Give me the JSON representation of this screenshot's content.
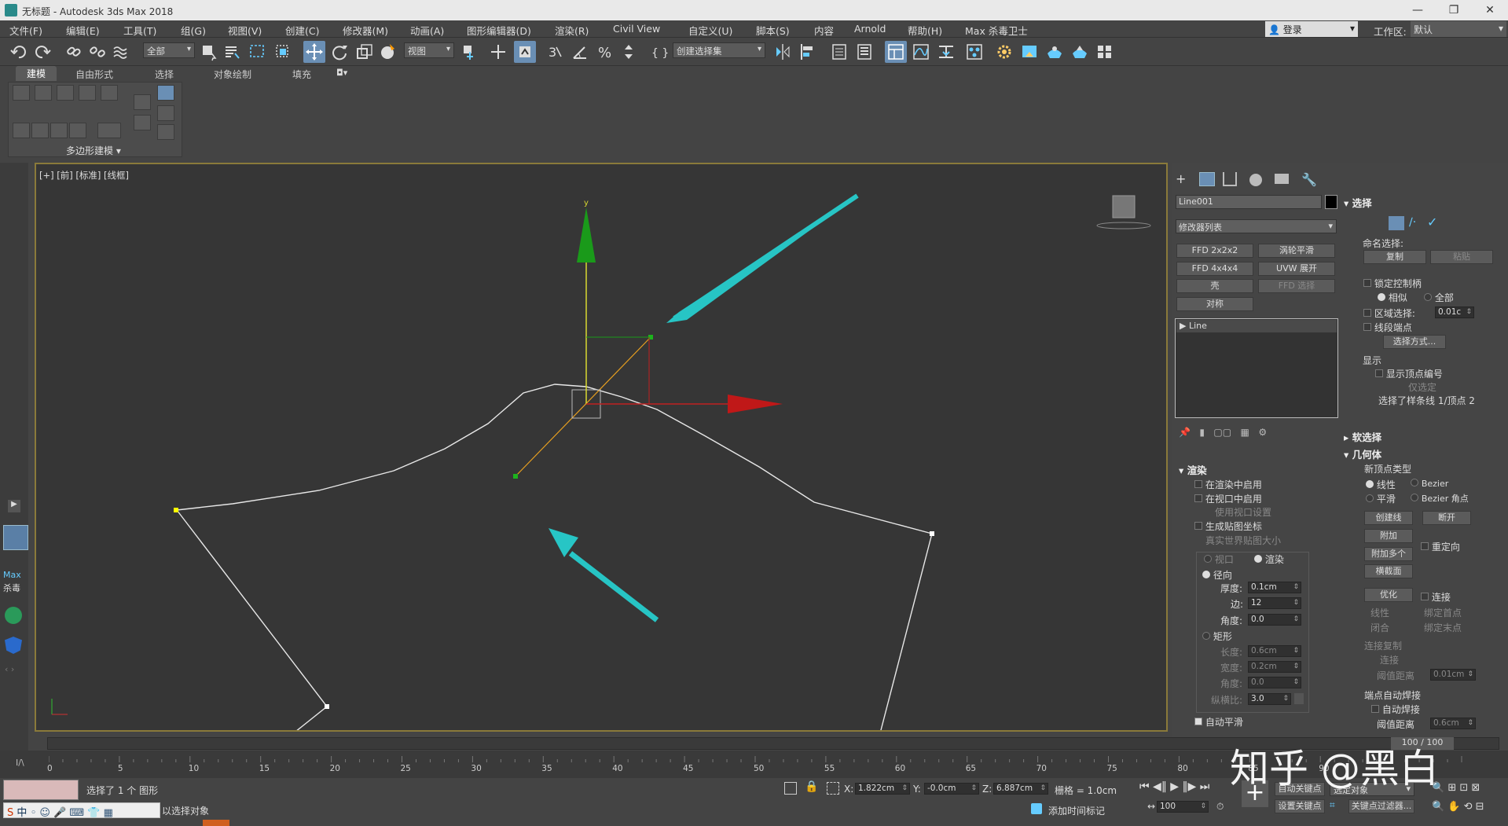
{
  "title_bar": {
    "title": "无标题 - Autodesk 3ds Max 2018",
    "min": "—",
    "max": "❐",
    "close": "✕"
  },
  "menus": [
    "文件(F)",
    "编辑(E)",
    "工具(T)",
    "组(G)",
    "视图(V)",
    "创建(C)",
    "修改器(M)",
    "动画(A)",
    "图形编辑器(D)",
    "渲染(R)",
    "Civil View",
    "自定义(U)",
    "脚本(S)",
    "内容",
    "Arnold",
    "帮助(H)",
    "Max 杀毒卫士"
  ],
  "login": "登录",
  "workspace": {
    "label": "工作区:",
    "value": "默认"
  },
  "toolbar": {
    "selection_filter": "全部",
    "ref_coord": "视图",
    "named_selection": "创建选择集"
  },
  "ribbon": {
    "tabs": [
      "建模",
      "自由形式",
      "选择",
      "对象绘制",
      "填充"
    ],
    "panel_label": "多边形建模"
  },
  "viewport": {
    "label": "[+] [前] [标准] [线框]",
    "gizmo_y": "y"
  },
  "left_sidebar": {
    "max_label_1": "Max",
    "max_label_2": "杀毒"
  },
  "command_panel": {
    "object_name": "Line001",
    "modifier_list": "修改器列表",
    "modifiers": [
      "FFD 2x2x2",
      "涡轮平滑",
      "FFD 4x4x4",
      "UVW 展开",
      "壳",
      "FFD 选择",
      "对称"
    ],
    "stack_item": "Line",
    "render": {
      "header": "渲染",
      "enable_in_render": "在渲染中启用",
      "enable_in_viewport": "在视口中启用",
      "use_viewport_settings": "使用视口设置",
      "gen_mapping": "生成贴图坐标",
      "real_world": "真实世界贴图大小",
      "viewport_opt": "视口",
      "render_opt": "渲染",
      "radial": "径向",
      "thickness_lbl": "厚度:",
      "thickness": "0.1cm",
      "sides_lbl": "边:",
      "sides": "12",
      "angle_lbl": "角度:",
      "angle": "0.0",
      "rectangular": "矩形",
      "length_lbl": "长度:",
      "length": "0.6cm",
      "width_lbl": "宽度:",
      "width": "0.2cm",
      "angle2_lbl": "角度:",
      "angle2": "0.0",
      "aspect_lbl": "纵横比:",
      "aspect": "3.0",
      "auto_smooth": "自动平滑"
    },
    "selection": {
      "header": "选择",
      "named_sel": "命名选择:",
      "copy": "复制",
      "paste": "粘贴",
      "lock_handles": "锁定控制柄",
      "alike": "相似",
      "all": "全部",
      "area_sel": "区域选择:",
      "area_val": "0.01c",
      "segment_end": "线段端点",
      "select_by": "选择方式...",
      "display": "显示",
      "show_vertex_nums": "显示顶点编号",
      "selected_only": "仅选定",
      "status": "选择了样条线 1/顶点 2"
    },
    "soft_sel": "软选择",
    "geometry": {
      "header": "几何体",
      "new_vertex_type": "新顶点类型",
      "linear": "线性",
      "bezier": "Bezier",
      "smooth": "平滑",
      "bezier_corner": "Bezier 角点",
      "create_line": "创建线",
      "break": "断开",
      "attach": "附加",
      "attach_mult": "附加多个",
      "reorient": "重定向",
      "cross_section": "横截面",
      "refine": "优化",
      "connect": "连接",
      "linear2": "线性",
      "bind_first": "绑定首点",
      "closed": "闭合",
      "bind_last": "绑定末点",
      "connect_copy": "连接复制",
      "connect2": "连接",
      "threshold": "阈值距离",
      "threshold_val": "0.01cm",
      "end_auto_weld": "端点自动焊接",
      "auto_weld": "自动焊接",
      "weld_threshold": "阈值距离",
      "weld_val": "0.6cm"
    }
  },
  "timeline": {
    "frame_display": "100 / 100",
    "ticks": [
      "0",
      "5",
      "10",
      "15",
      "20",
      "25",
      "30",
      "35",
      "40",
      "45",
      "50",
      "55",
      "60",
      "65",
      "70",
      "75",
      "80",
      "85",
      "90"
    ]
  },
  "status": {
    "selected": "选择了 1 个 图形",
    "hint": "以选择对象",
    "x_lbl": "X:",
    "x": "1.822cm",
    "y_lbl": "Y:",
    "y": "-0.0cm",
    "z_lbl": "Z:",
    "z": "6.887cm",
    "grid": "栅格 = 1.0cm",
    "add_time_tag": "添加时间标记",
    "auto_key": "自动关键点",
    "set_key": "设置关键点",
    "selected_obj": "选定对象",
    "key_filters": "关键点过滤器...",
    "frame": "100",
    "ime_text": "中"
  },
  "watermark": "知乎 @黑白"
}
